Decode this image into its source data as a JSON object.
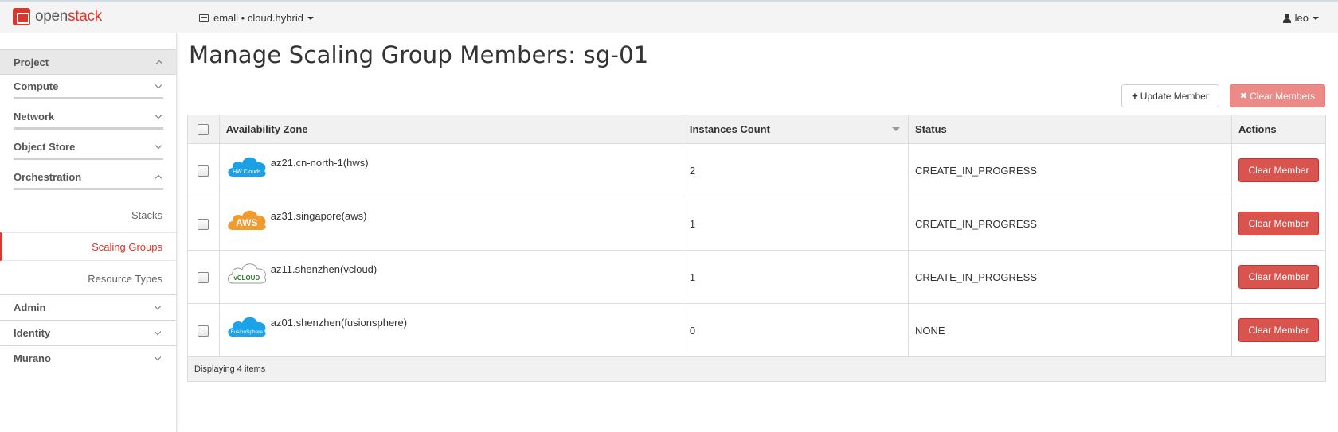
{
  "brand": {
    "open": "open",
    "stack": "stack",
    "accent": "#d9362c"
  },
  "topbar": {
    "project_icon": "server-icon",
    "project_label": "emall • cloud.hybrid",
    "user_icon": "user-icon",
    "user_label": "leo"
  },
  "sidebar": {
    "project": "Project",
    "groups": [
      {
        "label": "Compute"
      },
      {
        "label": "Network"
      },
      {
        "label": "Object Store"
      },
      {
        "label": "Orchestration"
      }
    ],
    "orchestration_items": [
      {
        "label": "Stacks"
      },
      {
        "label": "Scaling Groups"
      },
      {
        "label": "Resource Types"
      }
    ],
    "other_panels": [
      {
        "label": "Admin"
      },
      {
        "label": "Identity"
      },
      {
        "label": "Murano"
      }
    ]
  },
  "main": {
    "title": "Manage Scaling Group Members: sg-01",
    "update_button": "Update Member",
    "clear_all_button": "Clear Members",
    "table": {
      "headers": {
        "az": "Availability Zone",
        "count": "Instances Count",
        "status": "Status",
        "actions": "Actions"
      },
      "rows": [
        {
          "cloud": "HW Clouds",
          "cloud_color": "#1ea0e6",
          "az": "az21.cn-north-1(hws)",
          "count": "2",
          "status": "CREATE_IN_PROGRESS",
          "action": "Clear Member"
        },
        {
          "cloud": "AWS",
          "cloud_color": "#f19a2e",
          "az": "az31.singapore(aws)",
          "count": "1",
          "status": "CREATE_IN_PROGRESS",
          "action": "Clear Member"
        },
        {
          "cloud": "vCLOUD",
          "cloud_color": "#ffffff",
          "az": "az11.shenzhen(vcloud)",
          "count": "1",
          "status": "CREATE_IN_PROGRESS",
          "action": "Clear Member"
        },
        {
          "cloud": "FusionSphere",
          "cloud_color": "#1aa3e8",
          "az": "az01.shenzhen(fusionsphere)",
          "count": "0",
          "status": "NONE",
          "action": "Clear Member"
        }
      ],
      "footer": "Displaying 4 items"
    }
  }
}
